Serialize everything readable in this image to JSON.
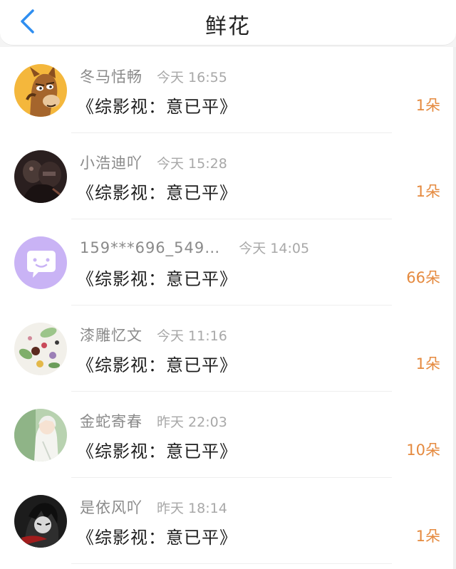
{
  "header": {
    "title": "鲜花"
  },
  "items": [
    {
      "username": "冬马恬畅",
      "time": "今天 16:55",
      "book": "《综影视：意已平》",
      "count": "1朵",
      "avatar_icon": "cartoon-horse-avatar"
    },
    {
      "username": "小浩迪吖",
      "time": "今天 15:28",
      "book": "《综影视：意已平》",
      "count": "1朵",
      "avatar_icon": "dark-photo-avatar"
    },
    {
      "username": "159***696_549…",
      "time": "今天 14:05",
      "book": "《综影视：意已平》",
      "count": "66朵",
      "avatar_icon": "default-chat-bubble-avatar"
    },
    {
      "username": "漆雕忆文",
      "time": "今天 11:16",
      "book": "《综影视：意已平》",
      "count": "1朵",
      "avatar_icon": "flowers-collage-avatar"
    },
    {
      "username": "金蛇寄春",
      "time": "昨天 22:03",
      "book": "《综影视：意已平》",
      "count": "10朵",
      "avatar_icon": "anime-character-avatar"
    },
    {
      "username": "是依风吖",
      "time": "昨天 18:14",
      "book": "《综影视：意已平》",
      "count": "1朵",
      "avatar_icon": "dark-anime-avatar"
    }
  ],
  "colors": {
    "accent_blue": "#2f8ef0",
    "count_orange": "#e58a3f",
    "default_avatar_purple": "#c9b3f5"
  }
}
